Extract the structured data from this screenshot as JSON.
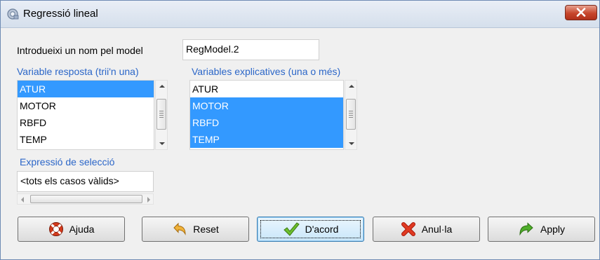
{
  "window": {
    "title": "Regressió lineal"
  },
  "model_name": {
    "label": "Introdueixi un nom pel model",
    "value": "RegModel.2"
  },
  "response": {
    "label": "Variable resposta (trii'n una)",
    "items": [
      {
        "text": "ATUR",
        "selected": true
      },
      {
        "text": "MOTOR",
        "selected": false
      },
      {
        "text": "RBFD",
        "selected": false
      },
      {
        "text": "TEMP",
        "selected": false
      }
    ]
  },
  "explanatory": {
    "label": "Variables explicatives (una o més)",
    "items": [
      {
        "text": "ATUR",
        "selected": false
      },
      {
        "text": "MOTOR",
        "selected": true
      },
      {
        "text": "RBFD",
        "selected": true
      },
      {
        "text": "TEMP",
        "selected": true
      }
    ]
  },
  "selection": {
    "label": "Expressió de selecció",
    "value": "<tots els casos vàlids>"
  },
  "buttons": {
    "help": "Ajuda",
    "reset": "Reset",
    "ok": "D'acord",
    "cancel": "Anul·la",
    "apply": "Apply"
  },
  "colors": {
    "selection": "#3399ff",
    "label_blue": "#2b66c8"
  }
}
